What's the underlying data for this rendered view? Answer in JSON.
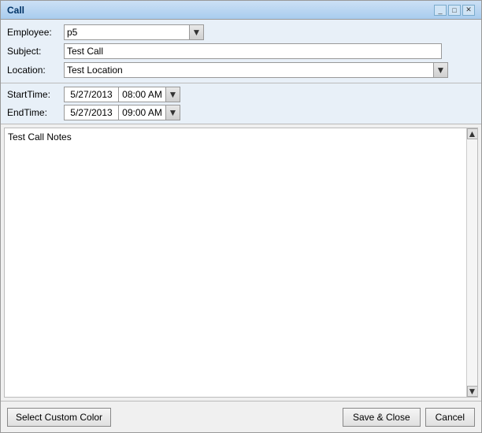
{
  "window": {
    "title": "Call",
    "title_extra": ""
  },
  "form": {
    "employee_label": "Employee:",
    "employee_value": "p5",
    "subject_label": "Subject:",
    "subject_value": "Test Call",
    "location_label": "Location:",
    "location_value": "Test Location",
    "starttime_label": "StartTime:",
    "start_date": "5/27/2013",
    "start_time": "08:00 AM",
    "endtime_label": "EndTime:",
    "end_date": "5/27/2013",
    "end_time": "09:00 AM",
    "notes_value": "Test Call Notes"
  },
  "footer": {
    "custom_color_label": "Select Custom Color",
    "save_close_label": "Save & Close",
    "cancel_label": "Cancel"
  },
  "icons": {
    "dropdown_arrow": "▼",
    "scroll_up": "▲",
    "scroll_down": "▼"
  }
}
